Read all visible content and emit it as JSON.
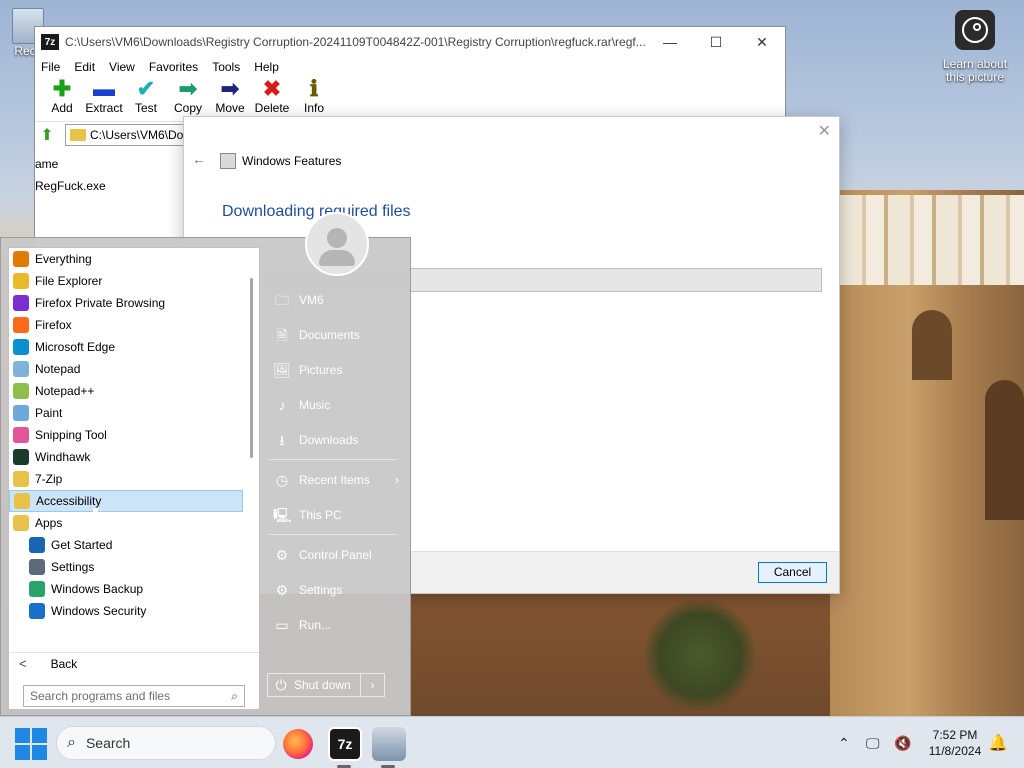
{
  "desktop": {
    "recycle_label": "Recy",
    "learn_label": "Learn about this picture"
  },
  "zip": {
    "title": "C:\\Users\\VM6\\Downloads\\Registry Corruption-20241109T004842Z-001\\Registry Corruption\\regfuck.rar\\regf...",
    "app_icon": "7z",
    "menu": [
      "File",
      "Edit",
      "View",
      "Favorites",
      "Tools",
      "Help"
    ],
    "toolbar": [
      {
        "label": "Add",
        "icon": "plus-icon",
        "glyph": "✚",
        "color": "#1aa11a"
      },
      {
        "label": "Extract",
        "icon": "minus-icon",
        "glyph": "▬",
        "color": "#1b3fd1"
      },
      {
        "label": "Test",
        "icon": "check-icon",
        "glyph": "✔",
        "color": "#1ab0b0"
      },
      {
        "label": "Copy",
        "icon": "copy-arrow-icon",
        "glyph": "➡",
        "color": "#1a9c6a"
      },
      {
        "label": "Move",
        "icon": "move-arrow-icon",
        "glyph": "➡",
        "color": "#1a237e"
      },
      {
        "label": "Delete",
        "icon": "delete-x-icon",
        "glyph": "✖",
        "color": "#d81b1b"
      },
      {
        "label": "Info",
        "icon": "info-icon",
        "glyph": "ℹ",
        "color": "#6b5a00"
      }
    ],
    "address": "C:\\Users\\VM6\\Do",
    "column_header": "ame",
    "files": [
      "RegFuck.exe"
    ]
  },
  "features": {
    "title": "Windows Features",
    "heading": "Downloading required files",
    "progress": 0,
    "cancel_label": "Cancel"
  },
  "start": {
    "programs": [
      {
        "label": "Everything",
        "icon": "search-app-icon",
        "color": "#e07b00",
        "sub": false
      },
      {
        "label": "File Explorer",
        "icon": "folder-icon",
        "color": "#e9b92e",
        "sub": false
      },
      {
        "label": "Firefox Private Browsing",
        "icon": "firefox-private-icon",
        "color": "#7b2fd1",
        "sub": false
      },
      {
        "label": "Firefox",
        "icon": "firefox-icon",
        "color": "#ff6a1a",
        "sub": false
      },
      {
        "label": "Microsoft Edge",
        "icon": "edge-icon",
        "color": "#0c8fd1",
        "sub": false
      },
      {
        "label": "Notepad",
        "icon": "notepad-icon",
        "color": "#7fb3d9",
        "sub": false
      },
      {
        "label": "Notepad++",
        "icon": "notepadpp-icon",
        "color": "#8dbf4a",
        "sub": false
      },
      {
        "label": "Paint",
        "icon": "paint-icon",
        "color": "#6fa8dc",
        "sub": false
      },
      {
        "label": "Snipping Tool",
        "icon": "snipping-icon",
        "color": "#e3559a",
        "sub": false
      },
      {
        "label": "Windhawk",
        "icon": "windhawk-icon",
        "color": "#1d3b2b",
        "sub": false
      },
      {
        "label": "7-Zip",
        "icon": "folder-icon",
        "color": "#e9c24a",
        "sub": false
      },
      {
        "label": "Accessibility",
        "icon": "folder-icon",
        "color": "#e9c24a",
        "sub": false,
        "selected": true
      },
      {
        "label": "Apps",
        "icon": "folder-icon",
        "color": "#e9c24a",
        "sub": false
      },
      {
        "label": "Get Started",
        "icon": "get-started-icon",
        "color": "#1766b5",
        "sub": true
      },
      {
        "label": "Settings",
        "icon": "gear-icon",
        "color": "#5b6b7b",
        "sub": true
      },
      {
        "label": "Windows Backup",
        "icon": "backup-icon",
        "color": "#2aa36b",
        "sub": true
      },
      {
        "label": "Windows Security",
        "icon": "shield-icon",
        "color": "#1a6fc9",
        "sub": true
      }
    ],
    "back_label": "Back",
    "search_placeholder": "Search programs and files",
    "right_items": [
      {
        "label": "VM6",
        "icon": "folder-icon"
      },
      {
        "label": "Documents",
        "icon": "document-icon"
      },
      {
        "label": "Pictures",
        "icon": "picture-icon"
      },
      {
        "label": "Music",
        "icon": "music-icon"
      },
      {
        "label": "Downloads",
        "icon": "download-icon"
      },
      {
        "label": "Recent Items",
        "icon": "clock-icon",
        "arrow": true
      },
      {
        "label": "This PC",
        "icon": "computer-icon"
      },
      {
        "label": "Control Panel",
        "icon": "control-panel-icon"
      },
      {
        "label": "Settings",
        "icon": "gear-icon"
      },
      {
        "label": "Run...",
        "icon": "run-icon"
      }
    ],
    "shutdown_label": "Shut down"
  },
  "taskbar": {
    "search_label": "Search",
    "sevenzip_label": "7z",
    "time": "7:52 PM",
    "date": "11/8/2024"
  }
}
